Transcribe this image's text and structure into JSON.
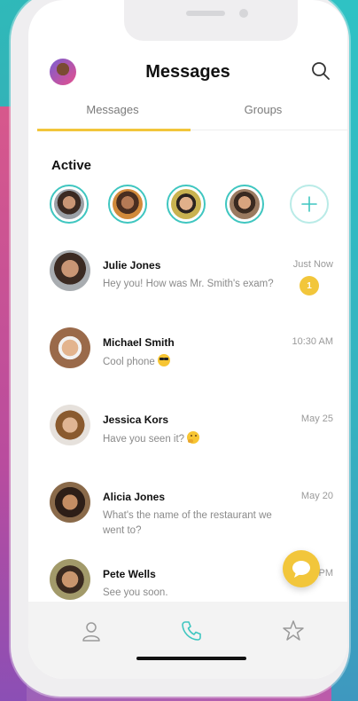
{
  "header": {
    "title": "Messages"
  },
  "tabs": [
    {
      "label": "Messages",
      "active": true
    },
    {
      "label": "Groups",
      "active": false
    }
  ],
  "active_section": {
    "label": "Active"
  },
  "conversations": [
    {
      "name": "Julie Jones",
      "message": "Hey you! How was Mr. Smith's exam?",
      "time": "Just Now",
      "unread": "1"
    },
    {
      "name": "Michael Smith",
      "message": "Cool phone",
      "emoji": "sunglasses",
      "time": "10:30 AM"
    },
    {
      "name": "Jessica Kors",
      "message": "Have you seen it?",
      "emoji": "thinking",
      "time": "May 25"
    },
    {
      "name": "Alicia Jones",
      "message": "What's the name of the restaurant we went to?",
      "time": "May 20"
    },
    {
      "name": "Pete Wells",
      "message": "See you soon.",
      "time": "PM"
    }
  ],
  "colors": {
    "accent_yellow": "#f2c63b",
    "accent_teal": "#3fc6c0"
  },
  "icons": [
    "search-icon",
    "plus-icon",
    "chat-bubble-icon",
    "person-icon",
    "phone-icon",
    "star-icon"
  ]
}
